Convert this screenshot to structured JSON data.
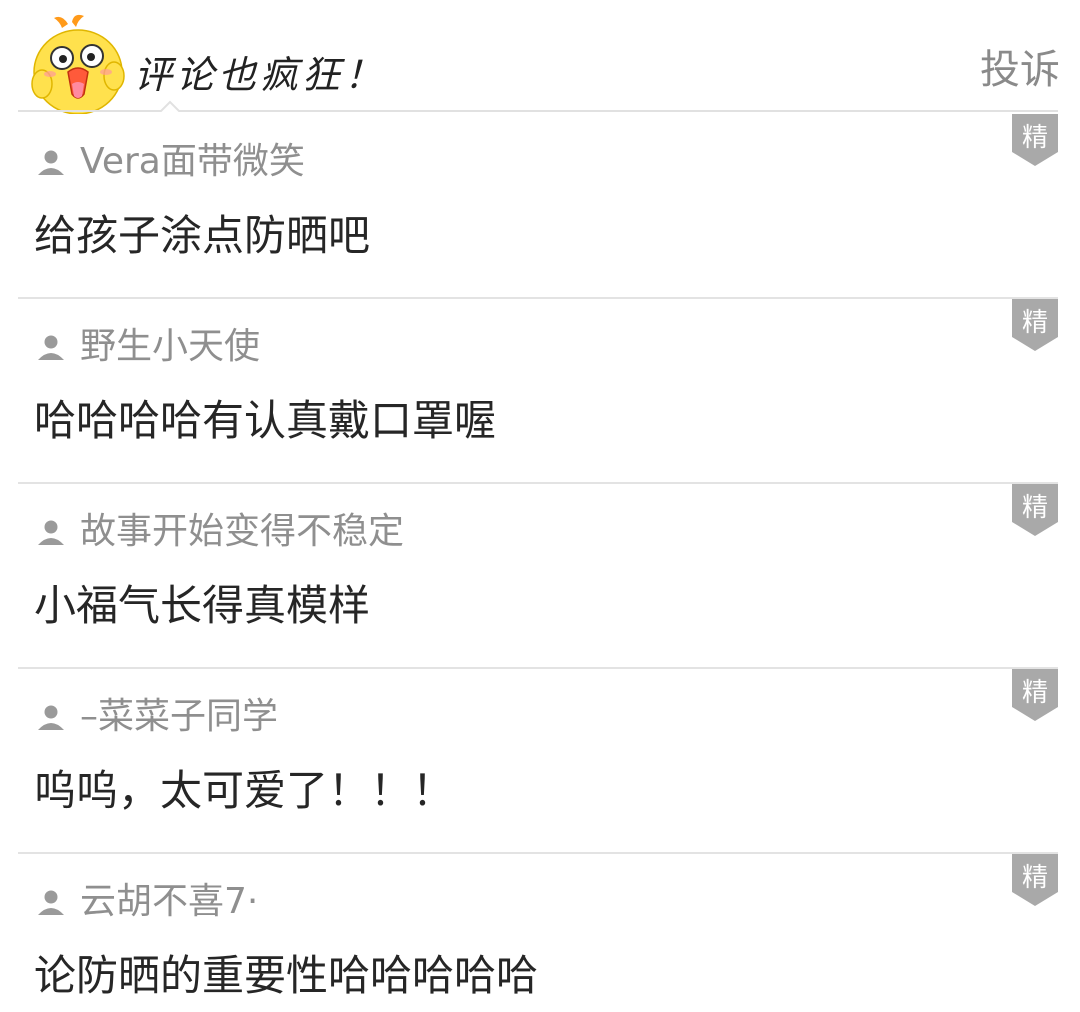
{
  "header": {
    "title": "评论也疯狂！",
    "complain_label": "投诉",
    "mascot_icon": "chick-mascot-icon"
  },
  "colors": {
    "username": "#8f8f8f",
    "comment_text": "#262626",
    "badge_bg": "#a9a9a9",
    "divider": "#e3e3e3",
    "mascot_yellow": "#ffe14d"
  },
  "comments": [
    {
      "username": "Vera面带微笑",
      "text": "给孩子涂点防晒吧",
      "badge": "精"
    },
    {
      "username": "野生小天使",
      "text": "哈哈哈哈有认真戴口罩喔",
      "badge": "精"
    },
    {
      "username": "故事开始变得不稳定",
      "text": "小福气长得真模样",
      "badge": "精"
    },
    {
      "username": "–菜菜子同学",
      "text": "呜呜，太可爱了！！！",
      "badge": "精"
    },
    {
      "username": "云胡不喜7·",
      "text": "论防晒的重要性哈哈哈哈哈",
      "badge": "精"
    }
  ]
}
